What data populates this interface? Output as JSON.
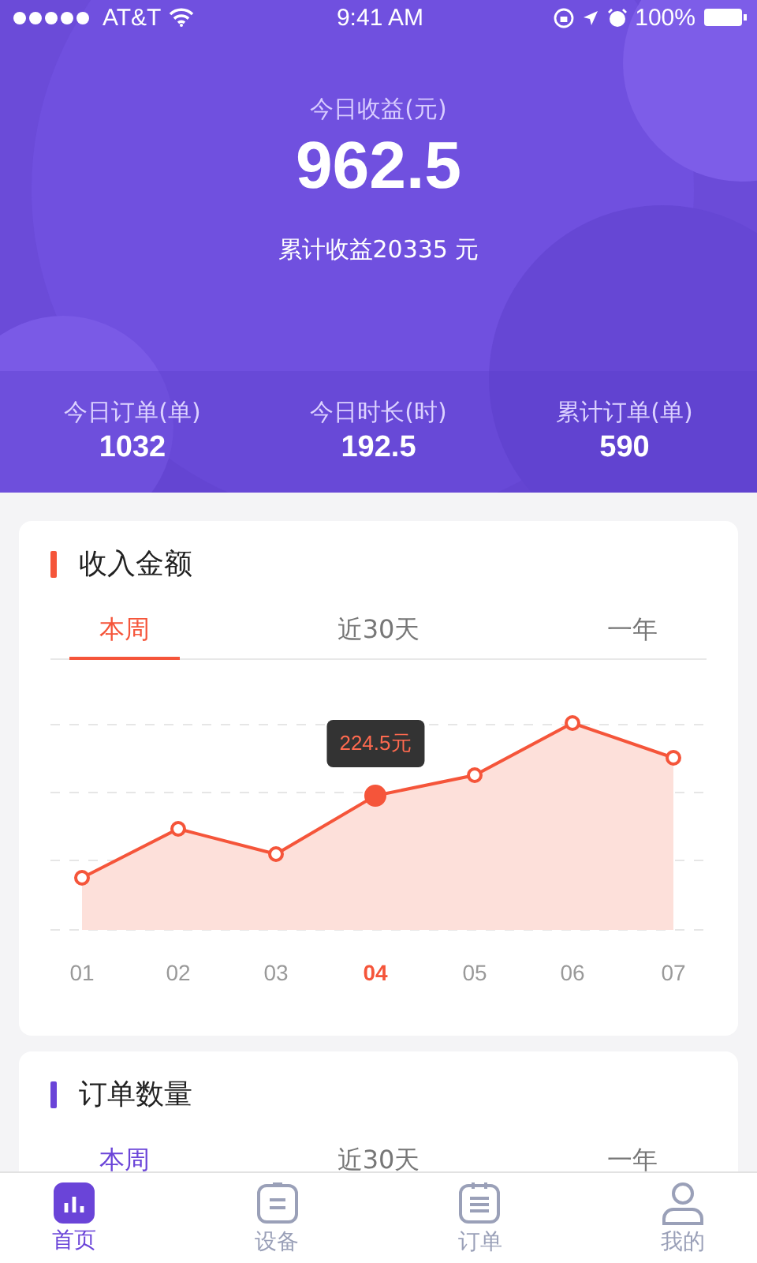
{
  "status_bar": {
    "carrier": "AT&T",
    "time": "9:41 AM",
    "battery": "100%"
  },
  "summary": {
    "title": "今日收益(元)",
    "value": "962.5",
    "total": "累计收益20335 元"
  },
  "stats": [
    {
      "label": "今日订单(单)",
      "value": "1032"
    },
    {
      "label": "今日时长(时)",
      "value": "192.5"
    },
    {
      "label": "累计订单(单)",
      "value": "590"
    }
  ],
  "cards": [
    {
      "title": "收入金额",
      "color": "#f5553a",
      "tabs": [
        {
          "label": "本周",
          "selected": true
        },
        {
          "label": "近30天",
          "selected": false
        },
        {
          "label": "一年",
          "selected": false
        }
      ],
      "chart": {
        "tooltip": "224.5元",
        "x_labels": [
          {
            "label": "01",
            "selected": false
          },
          {
            "label": "02",
            "selected": false
          },
          {
            "label": "03",
            "selected": false
          },
          {
            "label": "04",
            "selected": true
          },
          {
            "label": "05",
            "selected": false
          },
          {
            "label": "06",
            "selected": false
          },
          {
            "label": "07",
            "selected": false
          }
        ]
      }
    },
    {
      "title": "订单数量",
      "color": "#6a44d8",
      "tabs": [
        {
          "label": "本周",
          "selected": true
        },
        {
          "label": "近30天",
          "selected": false
        },
        {
          "label": "一年",
          "selected": false
        }
      ]
    }
  ],
  "tab_bar": [
    {
      "label": "首页",
      "selected": true
    },
    {
      "label": "设备",
      "selected": false
    },
    {
      "label": "订单",
      "selected": false
    },
    {
      "label": "我的",
      "selected": false
    }
  ]
}
